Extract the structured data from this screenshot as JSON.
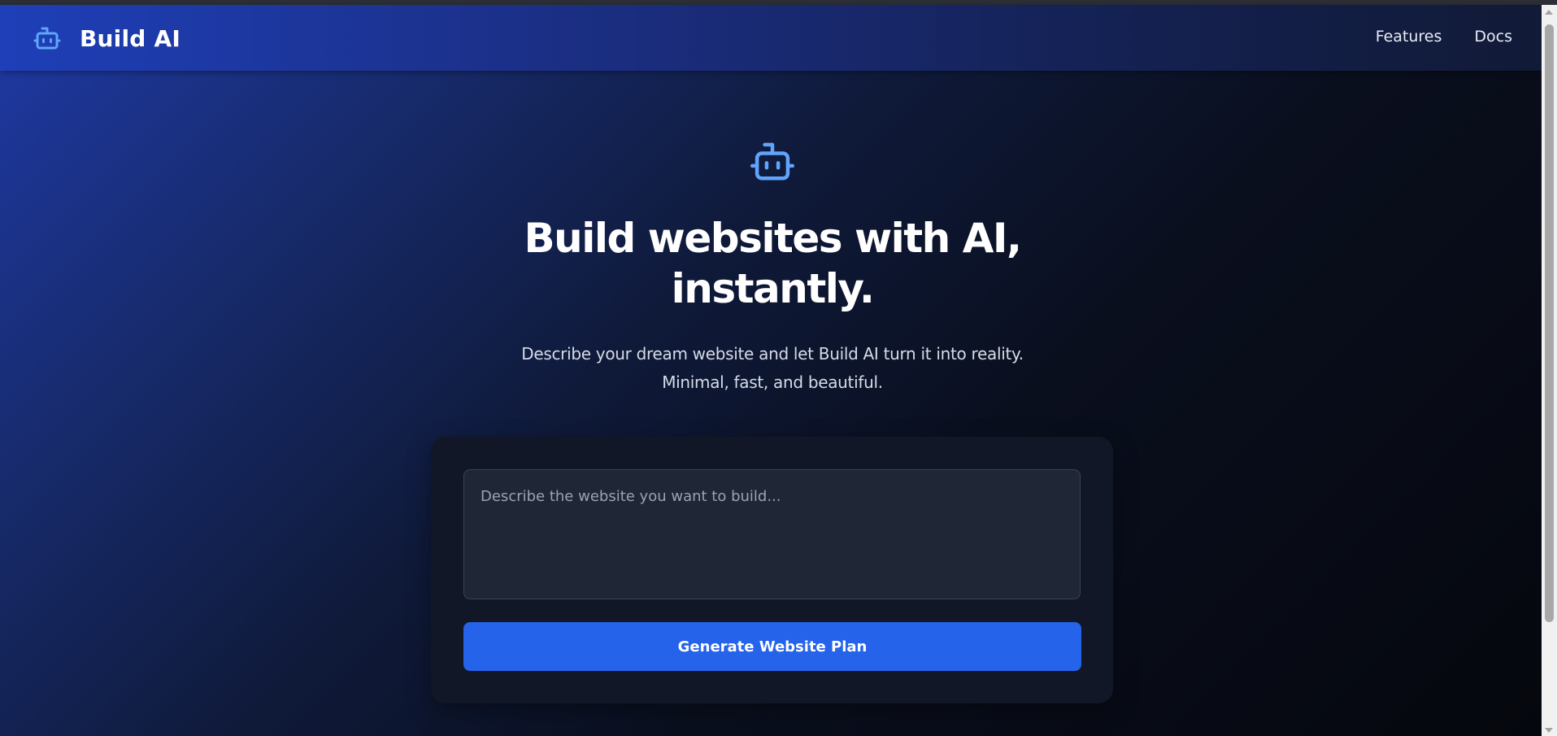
{
  "navbar": {
    "brand_name": "Build AI",
    "brand_icon": "robot-icon",
    "links": [
      "Features",
      "Docs"
    ]
  },
  "hero": {
    "icon": "robot-icon",
    "title_line1": "Build websites with AI,",
    "title_line2": "instantly.",
    "subtitle_line1": "Describe your dream website and let Build AI turn it into reality.",
    "subtitle_line2": "Minimal, fast, and beautiful."
  },
  "form": {
    "prompt_value": "",
    "prompt_placeholder": "Describe the website you want to build...",
    "submit_label": "Generate Website Plan"
  },
  "colors": {
    "accent": "#2563eb",
    "icon": "#60a5fa",
    "card_background": "#111726",
    "input_background": "#1f2736"
  }
}
